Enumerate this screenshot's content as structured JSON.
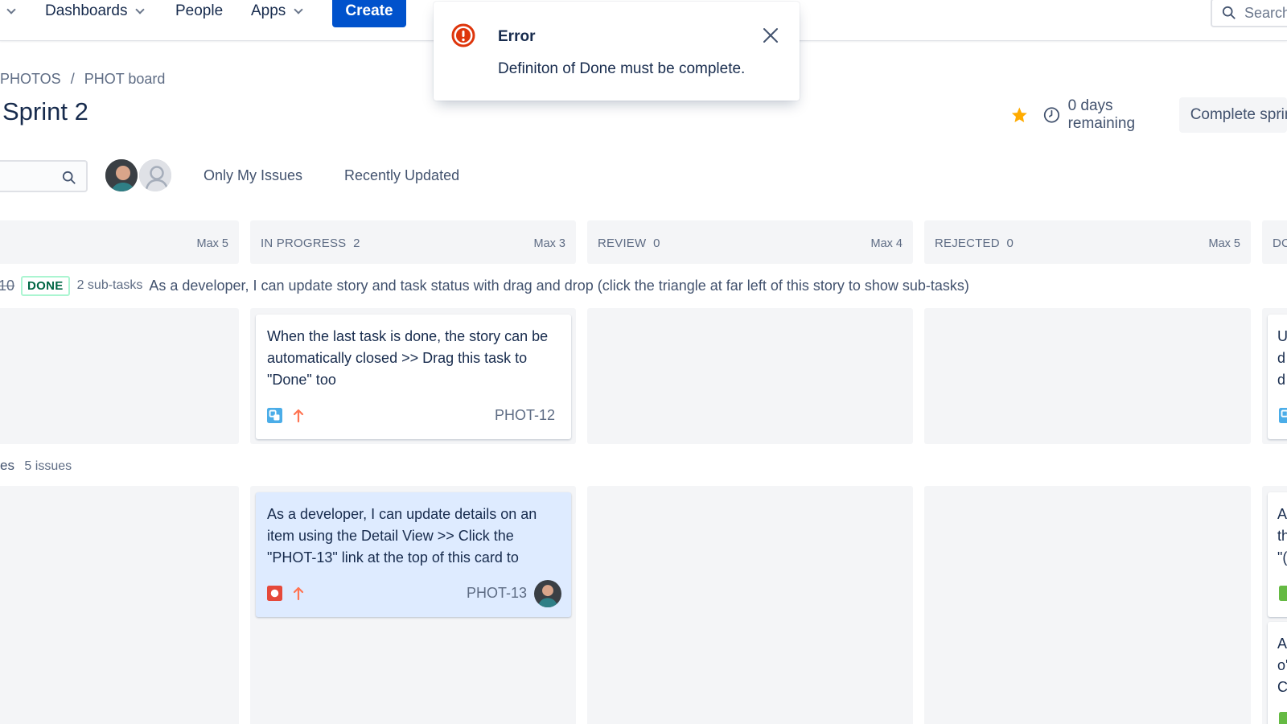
{
  "nav": {
    "items": [
      "Dashboards",
      "People",
      "Apps"
    ],
    "create_label": "Create",
    "search_placeholder": "Search"
  },
  "breadcrumb": [
    "PHOTOS",
    "/",
    "PHOT board"
  ],
  "sprint": {
    "title": "Sprint 2",
    "days_remaining": "0 days remaining",
    "complete_label": "Complete sprint"
  },
  "filters": {
    "only_my_issues": "Only My Issues",
    "recently_updated": "Recently Updated"
  },
  "columns": [
    {
      "name": "",
      "max": "Max 5"
    },
    {
      "name": "IN PROGRESS  2",
      "max": "Max 3"
    },
    {
      "name": "REVIEW  0",
      "max": "Max 4"
    },
    {
      "name": "REJECTED  0",
      "max": "Max 5"
    },
    {
      "name": "DC",
      "max": ""
    }
  ],
  "swimlane1": {
    "key": "10",
    "status": "DONE",
    "subtasks": "2 sub-tasks",
    "summary": "As a developer, I can update story and task status with drag and drop (click the triangle at far left of this story to show sub-tasks)"
  },
  "swimlane2": {
    "title": "es",
    "count": "5 issues"
  },
  "cards": [
    {
      "summary": "When the last task is done, the story can be automatically closed >> Drag this task to \"Done\" too",
      "key": "PHOT-12",
      "type_icon": "subtask-icon",
      "priority_icon": "priority-high-icon"
    },
    {
      "summary": "As a developer, I can update details on an item using the Detail View >> Click the \"PHOT-13\" link at the top of this card to",
      "key": "PHOT-13",
      "type_icon": "bug-icon",
      "priority_icon": "priority-high-icon"
    }
  ],
  "edge_cards": [
    [
      "U",
      "d",
      "d"
    ],
    [
      "A",
      "th",
      "\"("
    ],
    [
      "A",
      "o'",
      "C"
    ]
  ],
  "flag": {
    "title": "Error",
    "message": "Definiton of Done must be complete."
  },
  "colors": {
    "primary": "#0052CC",
    "error": "#DE350B",
    "done_green": "#006644",
    "priority_orange": "#FF7452",
    "star": "#FFAB00"
  }
}
